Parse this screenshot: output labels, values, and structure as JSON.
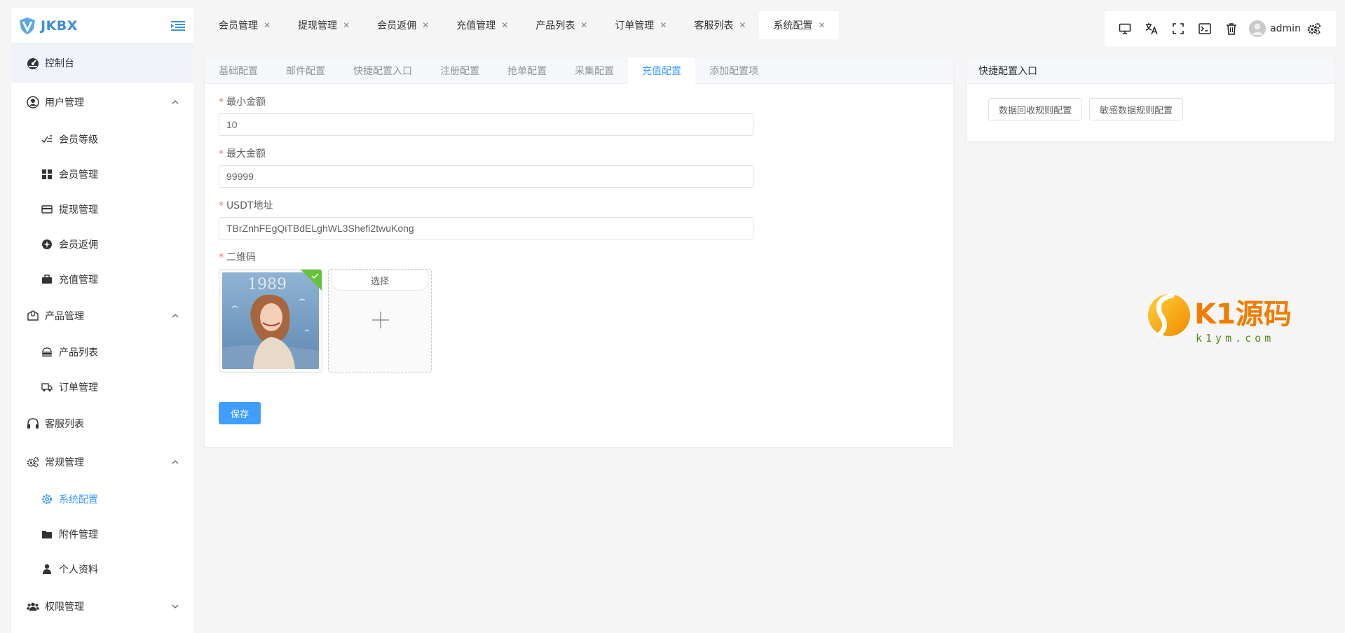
{
  "brand": {
    "name": "JKBX"
  },
  "sidebar": {
    "items": [
      {
        "label": "控制台",
        "icon": "dashboard-icon"
      },
      {
        "label": "用户管理",
        "icon": "user-circle-icon"
      },
      {
        "label": "会员等级",
        "icon": "level-icon"
      },
      {
        "label": "会员管理",
        "icon": "grid-icon"
      },
      {
        "label": "提现管理",
        "icon": "card-icon"
      },
      {
        "label": "会员返佣",
        "icon": "commission-icon"
      },
      {
        "label": "充值管理",
        "icon": "briefcase-icon"
      },
      {
        "label": "产品管理",
        "icon": "package-icon"
      },
      {
        "label": "产品列表",
        "icon": "product-list-icon"
      },
      {
        "label": "订单管理",
        "icon": "truck-icon"
      },
      {
        "label": "客服列表",
        "icon": "headset-icon"
      },
      {
        "label": "常规管理",
        "icon": "gears-icon"
      },
      {
        "label": "系统配置",
        "icon": "gear-icon"
      },
      {
        "label": "附件管理",
        "icon": "folder-icon"
      },
      {
        "label": "个人资料",
        "icon": "person-icon"
      },
      {
        "label": "权限管理",
        "icon": "users-icon"
      }
    ]
  },
  "tabs": [
    {
      "label": "会员管理"
    },
    {
      "label": "提现管理"
    },
    {
      "label": "会员返佣"
    },
    {
      "label": "充值管理"
    },
    {
      "label": "产品列表"
    },
    {
      "label": "订单管理"
    },
    {
      "label": "客服列表"
    },
    {
      "label": "系统配置"
    }
  ],
  "toolbar": {
    "username": "admin"
  },
  "config_tabs": [
    {
      "label": "基础配置"
    },
    {
      "label": "邮件配置"
    },
    {
      "label": "快捷配置入口"
    },
    {
      "label": "注册配置"
    },
    {
      "label": "抢单配置"
    },
    {
      "label": "采集配置"
    },
    {
      "label": "充值配置"
    },
    {
      "label": "添加配置项"
    }
  ],
  "form": {
    "min_amount": {
      "label": "最小金额",
      "value": "10"
    },
    "max_amount": {
      "label": "最大金额",
      "value": "99999"
    },
    "usdt_address": {
      "label": "USDT地址",
      "value": "TBrZnhFEgQiTBdELghWL3Shefi2twuKong"
    },
    "qrcode": {
      "label": "二维码",
      "select_label": "选择"
    },
    "save_label": "保存"
  },
  "quick": {
    "title": "快捷配置入口",
    "buttons": [
      {
        "label": "数据回收规则配置"
      },
      {
        "label": "敏感数据规则配置"
      }
    ]
  },
  "watermark": {
    "main": "K1源码",
    "sub": "k1ym.com"
  },
  "colors": {
    "primary": "#409eff",
    "brand": "#3e8ed9",
    "required": "#f56c6c",
    "success": "#67c23a"
  }
}
